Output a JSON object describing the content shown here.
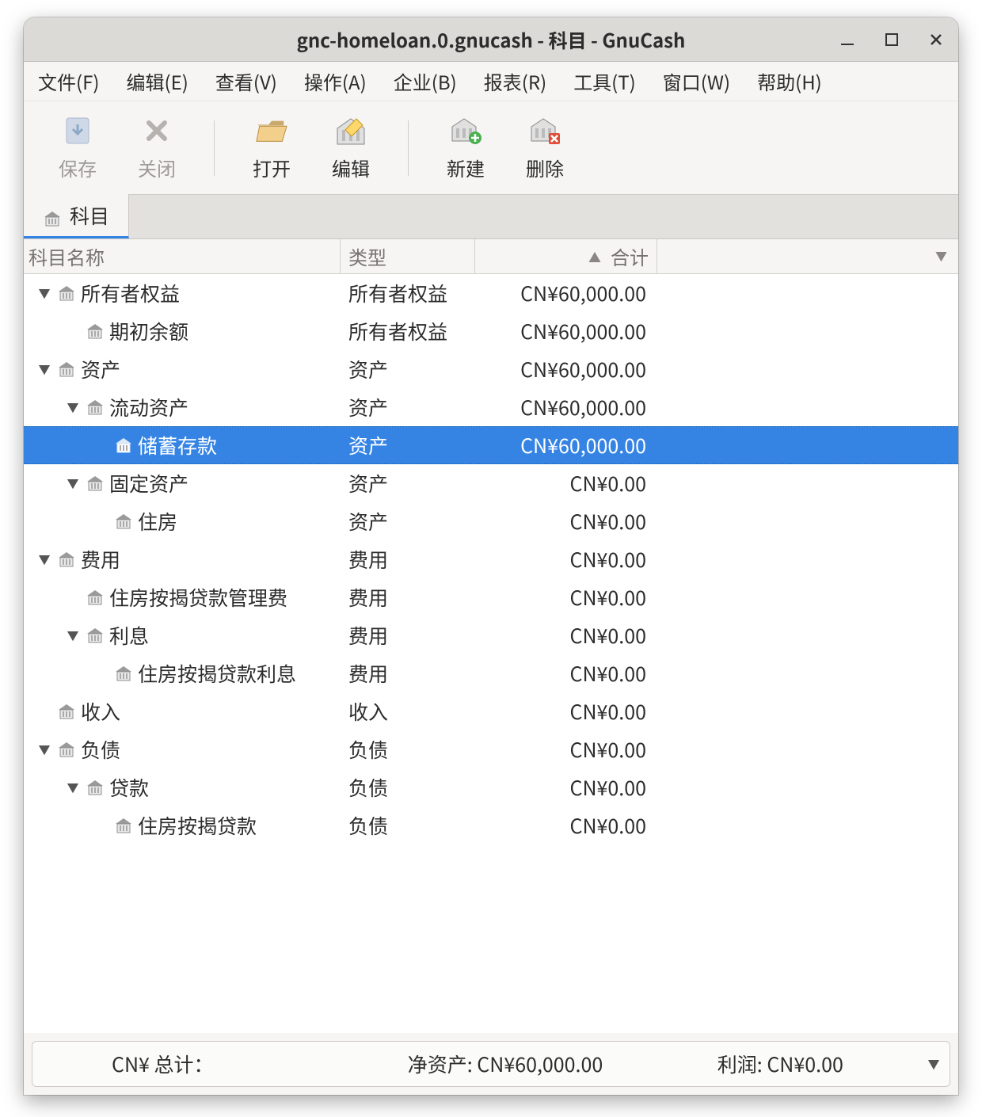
{
  "window": {
    "title": "gnc-homeloan.0.gnucash - 科目 - GnuCash"
  },
  "menu": {
    "file": "文件(F)",
    "edit": "编辑(E)",
    "view": "查看(V)",
    "actions": "操作(A)",
    "business": "企业(B)",
    "reports": "报表(R)",
    "tools": "工具(T)",
    "window": "窗口(W)",
    "help": "帮助(H)"
  },
  "toolbar": {
    "save": "保存",
    "close": "关闭",
    "open": "打开",
    "edit": "编辑",
    "new": "新建",
    "delete": "删除"
  },
  "tab": {
    "accounts": "科目"
  },
  "columns": {
    "name": "科目名称",
    "type": "类型",
    "total": "合计"
  },
  "rows": [
    {
      "indent": 0,
      "expander": "down",
      "name": "所有者权益",
      "type": "所有者权益",
      "total": "CN¥60,000.00",
      "selected": false
    },
    {
      "indent": 1,
      "expander": "",
      "name": "期初余额",
      "type": "所有者权益",
      "total": "CN¥60,000.00",
      "selected": false
    },
    {
      "indent": 0,
      "expander": "down",
      "name": "资产",
      "type": "资产",
      "total": "CN¥60,000.00",
      "selected": false
    },
    {
      "indent": 1,
      "expander": "down",
      "name": "流动资产",
      "type": "资产",
      "total": "CN¥60,000.00",
      "selected": false
    },
    {
      "indent": 2,
      "expander": "",
      "name": "储蓄存款",
      "type": "资产",
      "total": "CN¥60,000.00",
      "selected": true
    },
    {
      "indent": 1,
      "expander": "down",
      "name": "固定资产",
      "type": "资产",
      "total": "CN¥0.00",
      "selected": false
    },
    {
      "indent": 2,
      "expander": "",
      "name": "住房",
      "type": "资产",
      "total": "CN¥0.00",
      "selected": false
    },
    {
      "indent": 0,
      "expander": "down",
      "name": "费用",
      "type": "费用",
      "total": "CN¥0.00",
      "selected": false
    },
    {
      "indent": 1,
      "expander": "",
      "name": "住房按揭贷款管理费",
      "type": "费用",
      "total": "CN¥0.00",
      "selected": false
    },
    {
      "indent": 1,
      "expander": "down",
      "name": "利息",
      "type": "费用",
      "total": "CN¥0.00",
      "selected": false
    },
    {
      "indent": 2,
      "expander": "",
      "name": "住房按揭贷款利息",
      "type": "费用",
      "total": "CN¥0.00",
      "selected": false
    },
    {
      "indent": 0,
      "expander": "",
      "name": "收入",
      "type": "收入",
      "total": "CN¥0.00",
      "selected": false
    },
    {
      "indent": 0,
      "expander": "down",
      "name": "负债",
      "type": "负债",
      "total": "CN¥0.00",
      "selected": false
    },
    {
      "indent": 1,
      "expander": "down",
      "name": "贷款",
      "type": "负债",
      "total": "CN¥0.00",
      "selected": false
    },
    {
      "indent": 2,
      "expander": "",
      "name": "住房按揭贷款",
      "type": "负债",
      "total": "CN¥0.00",
      "selected": false
    }
  ],
  "status": {
    "currency_total": "CN¥ 总计：",
    "net_assets": "净资产: CN¥60,000.00",
    "profit": "利润: CN¥0.00"
  }
}
